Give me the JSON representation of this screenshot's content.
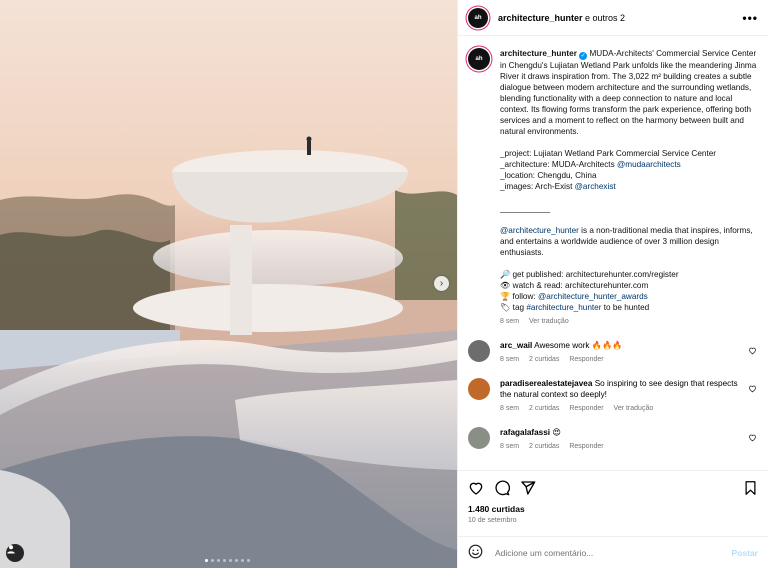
{
  "header": {
    "username": "architecture_hunter",
    "suffix": " e outros 2",
    "more_label": "•••"
  },
  "caption": {
    "username": "architecture_hunter",
    "text": "MUDA-Architects' Commercial Service Center in Chengdu's Lujiatan Wetland Park unfolds like the meandering Jinma River it draws inspiration from. The 3,022 m² building creates a subtle dialogue between modern architecture and the surrounding wetlands, blending functionality with a deep connection to nature and local context. Its flowing forms transform the park experience, offering both services and a moment to reflect on the harmony between built and natural environments.",
    "project": "_project: Lujiatan Wetland Park Commercial Service Center",
    "architecture_prefix": "_architecture: MUDA-Architects ",
    "architecture_handle": "@mudaarchitects",
    "location": "_location: Chengdu, China",
    "images_prefix": "_images: Arch-Exist ",
    "images_handle": "@archexist",
    "divider": "___________",
    "about_handle": "@architecture_hunter",
    "about_text": " is a non-traditional media that inspires, informs, and entertains a worldwide audience of over 3 million design enthusiasts.",
    "line1": "🔎 get published: architecturehunter.com/register",
    "line2": "👁 watch & read: architecturehunter.com",
    "line3_prefix": "🏆 follow: ",
    "line3_handle": "@architecture_hunter_awards",
    "line4_prefix": "🏷 tag ",
    "line4_handle": "#architecture_hunter",
    "line4_suffix": " to be hunted",
    "time": "8 sem",
    "translate": "Ver tradução"
  },
  "comments": [
    {
      "username": "arc_wail",
      "text": "Awesome work 🔥🔥🔥",
      "time": "8 sem",
      "likes": "2 curtidas",
      "reply": "Responder",
      "translate": "",
      "avatar_color": "#6d6d6d"
    },
    {
      "username": "paradiserealestatejavea",
      "text": "So inspiring to see design that respects the natural context so deeply!",
      "time": "8 sem",
      "likes": "2 curtidas",
      "reply": "Responder",
      "translate": "Ver tradução",
      "avatar_color": "#c0692b"
    },
    {
      "username": "rafagalafassi",
      "text": "😍",
      "time": "8 sem",
      "likes": "2 curtidas",
      "reply": "Responder",
      "translate": "",
      "avatar_color": "#8a8f86"
    }
  ],
  "footer": {
    "likes": "1.480 curtidas",
    "date": "10 de setembro",
    "comment_placeholder": "Adicione um comentário...",
    "post_label": "Postar"
  },
  "carousel": {
    "slide_count": 8,
    "active_index": 0
  },
  "colors": {
    "link": "#00376b",
    "verified": "#0095f6",
    "muted": "#737373",
    "post_button": "#b2dffc"
  }
}
